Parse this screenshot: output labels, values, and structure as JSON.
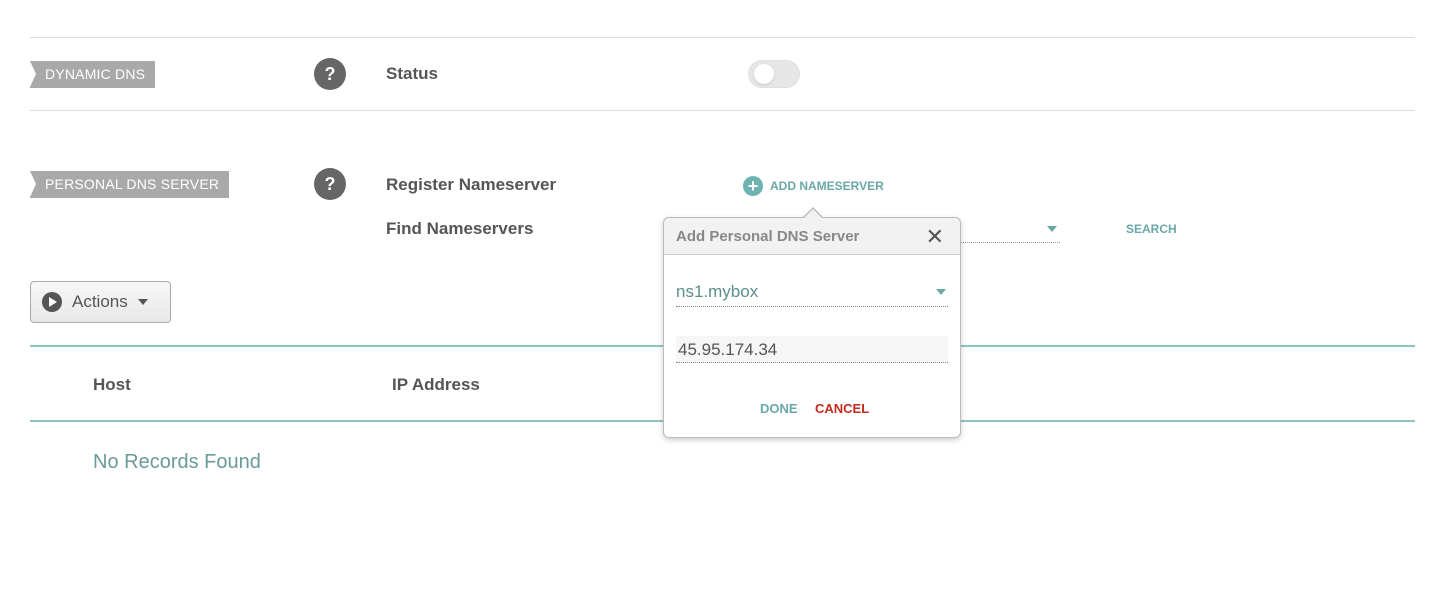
{
  "dynamic_dns": {
    "tag": "DYNAMIC DNS",
    "help": "?",
    "status_label": "Status",
    "status_on": false
  },
  "personal_dns": {
    "tag": "PERSONAL DNS SERVER",
    "help": "?",
    "register_label": "Register Nameserver",
    "add_button": "ADD NAMESERVER",
    "add_icon": "+",
    "find_label": "Find Nameservers",
    "search_button": "SEARCH"
  },
  "actions": {
    "label": "Actions"
  },
  "table": {
    "columns": [
      "Host",
      "IP Address"
    ],
    "empty_text": "No Records Found"
  },
  "popup": {
    "title": "Add Personal DNS Server",
    "close": "✕",
    "nameserver_value": "ns1.mybox",
    "ip_value": "45.95.174.34",
    "done": "DONE",
    "cancel": "CANCEL"
  },
  "colors": {
    "accent": "#6aa8a8",
    "cancel": "#c42b1c",
    "tag_bg": "#a9a9a9"
  }
}
